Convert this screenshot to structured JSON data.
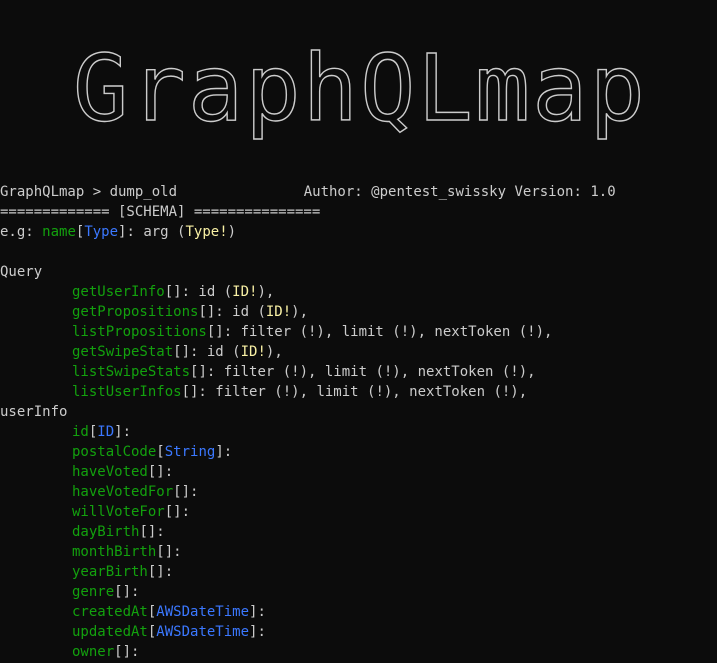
{
  "banner": {
    "art_text": "GraphQLmap",
    "author_label": "Author:",
    "author_handle": "@pentest_swissky",
    "version_label": "Version:",
    "version_value": "1.0"
  },
  "prompt": {
    "text": "GraphQLmap > ",
    "command": "dump_old"
  },
  "schema_header": "============= [SCHEMA] ===============",
  "example": {
    "prefix": "e.g: ",
    "name": "name",
    "type_open": "[",
    "type": "Type",
    "type_close": "]",
    "colon": ": arg (",
    "arg_type": "Type!",
    "close": ")"
  },
  "query": {
    "title": "Query",
    "fields": [
      {
        "name": "getUserInfo",
        "rest": "[]: id (",
        "argtype": "ID!",
        "tail": "),"
      },
      {
        "name": "getPropositions",
        "rest": "[]: id (",
        "argtype": "ID!",
        "tail": "),"
      },
      {
        "name": "listPropositions",
        "rest": "[]: filter (!), limit (!), nextToken (!),",
        "argtype": "",
        "tail": ""
      },
      {
        "name": "getSwipeStat",
        "rest": "[]: id (",
        "argtype": "ID!",
        "tail": "),"
      },
      {
        "name": "listSwipeStats",
        "rest": "[]: filter (!), limit (!), nextToken (!),",
        "argtype": "",
        "tail": ""
      },
      {
        "name": "listUserInfos",
        "rest": "[]: filter (!), limit (!), nextToken (!),",
        "argtype": "",
        "tail": ""
      }
    ]
  },
  "userinfo": {
    "title": "userInfo",
    "fields": [
      {
        "name": "id",
        "type": "ID"
      },
      {
        "name": "postalCode",
        "type": "String"
      },
      {
        "name": "haveVoted",
        "type": ""
      },
      {
        "name": "haveVotedFor",
        "type": ""
      },
      {
        "name": "willVoteFor",
        "type": ""
      },
      {
        "name": "dayBirth",
        "type": ""
      },
      {
        "name": "monthBirth",
        "type": ""
      },
      {
        "name": "yearBirth",
        "type": ""
      },
      {
        "name": "genre",
        "type": ""
      },
      {
        "name": "createdAt",
        "type": "AWSDateTime"
      },
      {
        "name": "updatedAt",
        "type": "AWSDateTime"
      },
      {
        "name": "owner",
        "type": ""
      }
    ]
  },
  "colors": {
    "background": "#0c0c0c",
    "foreground": "#cccccc",
    "field_name": "#13a10e",
    "type_name": "#3b78ff",
    "arg_type": "#f9f1a5"
  }
}
